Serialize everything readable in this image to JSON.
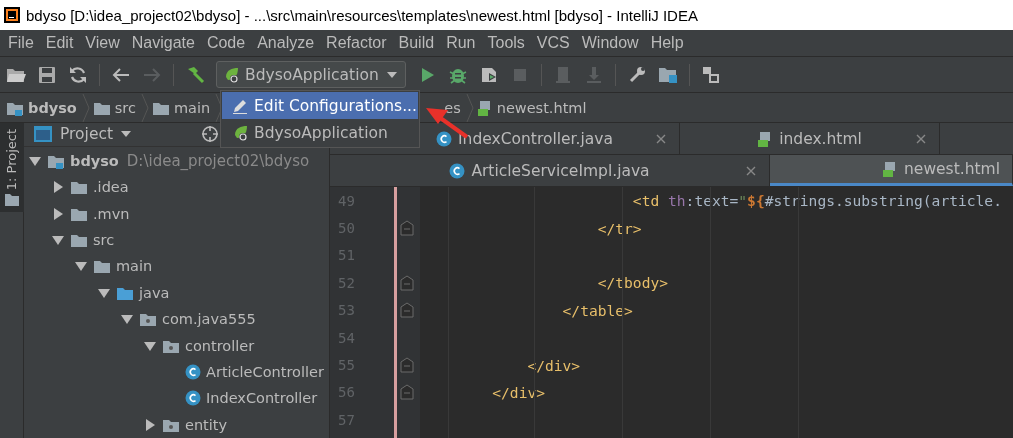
{
  "window": {
    "title": "bdyso [D:\\idea_project02\\bdyso] - ...\\src\\main\\resources\\templates\\newest.html [bdyso] - IntelliJ IDEA"
  },
  "menu": [
    "File",
    "Edit",
    "View",
    "Navigate",
    "Code",
    "Analyze",
    "Refactor",
    "Build",
    "Run",
    "Tools",
    "VCS",
    "Window",
    "Help"
  ],
  "toolbar": {
    "run_config": "BdysoApplication"
  },
  "breadcrumbs": [
    {
      "label": "bdyso",
      "kind": "project"
    },
    {
      "label": "src",
      "kind": "folder"
    },
    {
      "label": "main",
      "kind": "folder"
    },
    {
      "label": "es",
      "kind": "partial"
    },
    {
      "label": "newest.html",
      "kind": "html"
    }
  ],
  "tool_stripe": {
    "label": "1: Project",
    "selected": true
  },
  "project_panel": {
    "title": "Project",
    "tree": [
      {
        "label": "bdyso",
        "path": "D:\\idea_project02\\bdyso",
        "kind": "module",
        "expanded": true,
        "children": [
          {
            "label": ".idea",
            "kind": "folder",
            "expanded": false
          },
          {
            "label": ".mvn",
            "kind": "folder",
            "expanded": false
          },
          {
            "label": "src",
            "kind": "folder",
            "expanded": true,
            "children": [
              {
                "label": "main",
                "kind": "folder",
                "expanded": true,
                "children": [
                  {
                    "label": "java",
                    "kind": "source",
                    "expanded": true,
                    "children": [
                      {
                        "label": "com.java555",
                        "kind": "package",
                        "expanded": true,
                        "children": [
                          {
                            "label": "controller",
                            "kind": "package",
                            "expanded": true,
                            "children": [
                              {
                                "label": "ArticleController",
                                "kind": "class"
                              },
                              {
                                "label": "IndexController",
                                "kind": "class"
                              }
                            ]
                          },
                          {
                            "label": "entity",
                            "kind": "package",
                            "expanded": false
                          }
                        ]
                      }
                    ]
                  }
                ]
              }
            ]
          }
        ]
      }
    ]
  },
  "editor": {
    "tab_rows": [
      [
        {
          "label": "IndexController.java",
          "kind": "class",
          "selected": false
        },
        {
          "label": "index.html",
          "kind": "html",
          "selected": false
        }
      ],
      [
        {
          "label": "ArticleServiceImpl.java",
          "kind": "class",
          "selected": false
        },
        {
          "label": "newest.html",
          "kind": "html",
          "selected": true
        }
      ]
    ],
    "lines": [
      {
        "number": "49",
        "fold": false,
        "tokens": [
          {
            "text": "                        <td ",
            "kind": "tag"
          },
          {
            "text": "th",
            "kind": "ns"
          },
          {
            "text": ":text=",
            "kind": "plain"
          },
          {
            "text": "\"",
            "kind": "string"
          },
          {
            "text": "${",
            "kind": "keyword"
          },
          {
            "text": "#strings.substring(article.",
            "kind": "plain"
          }
        ]
      },
      {
        "number": "50",
        "fold": true,
        "tokens": [
          {
            "text": "                    </tr>",
            "kind": "tag"
          }
        ]
      },
      {
        "number": "51",
        "fold": false
      },
      {
        "number": "52",
        "fold": true,
        "tokens": [
          {
            "text": "                    </tbody>",
            "kind": "tag"
          }
        ]
      },
      {
        "number": "53",
        "fold": true,
        "tokens": [
          {
            "text": "                </table>",
            "kind": "tag"
          }
        ]
      },
      {
        "number": "54",
        "fold": false
      },
      {
        "number": "55",
        "fold": true,
        "tokens": [
          {
            "text": "            </div>",
            "kind": "tag"
          }
        ]
      },
      {
        "number": "56",
        "fold": true,
        "tokens": [
          {
            "text": "        </div>",
            "kind": "tag"
          }
        ]
      },
      {
        "number": "57",
        "fold": false
      }
    ]
  },
  "popup": {
    "items": [
      {
        "label": "Edit Configurations...",
        "kind": "edit",
        "selected": true
      },
      {
        "label": "BdysoApplication",
        "kind": "app",
        "selected": false
      }
    ]
  }
}
